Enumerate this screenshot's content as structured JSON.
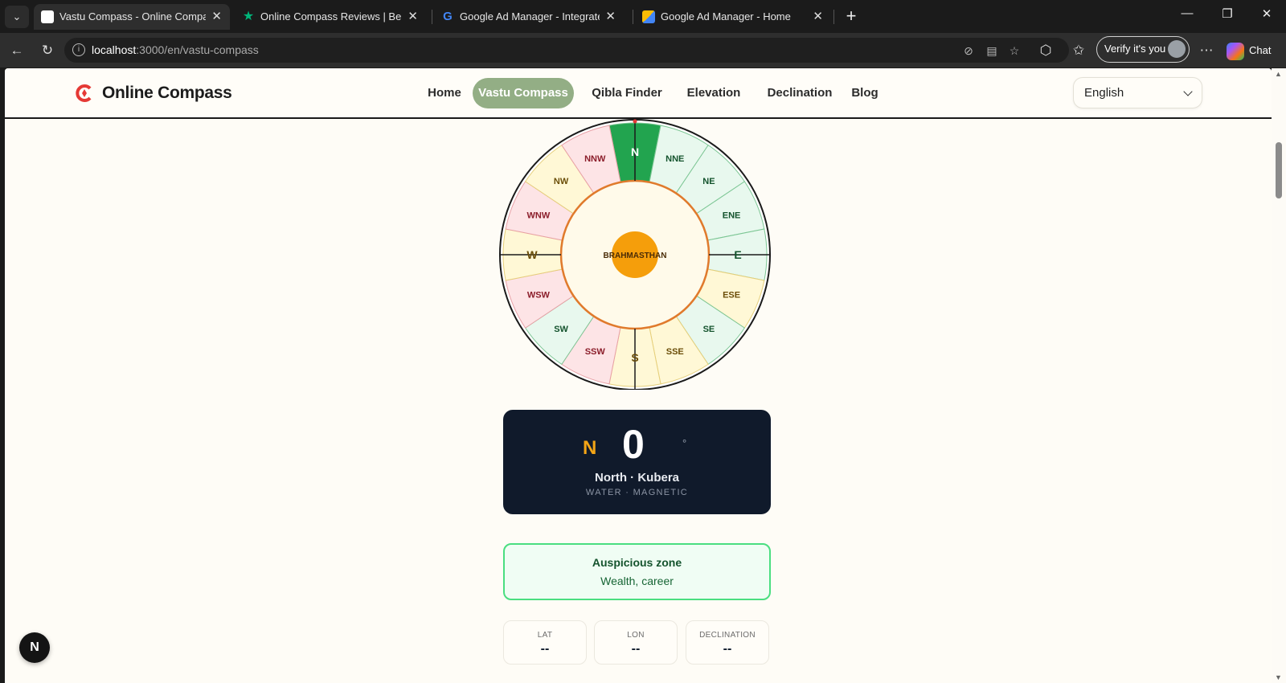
{
  "browser": {
    "tabs": [
      {
        "title": "Vastu Compass - Online Compass",
        "favicon_color": "#e53935",
        "active": true
      },
      {
        "title": "Online Compass Reviews | Be the fi",
        "favicon_color": "#00b67a",
        "active": false
      },
      {
        "title": "Google Ad Manager - Integrated A",
        "favicon_color": "#4285f4",
        "active": false
      },
      {
        "title": "Google Ad Manager - Home",
        "favicon_color": "#fbbc04",
        "active": false
      }
    ],
    "url_host": "localhost",
    "url_rest": ":3000/en/vastu-compass",
    "verify_label": "Verify it's you",
    "chat_label": "Chat"
  },
  "site": {
    "brand": "Online Compass",
    "nav": [
      "Home",
      "Vastu Compass",
      "Qibla Finder",
      "Elevation",
      "Declination",
      "Blog"
    ],
    "active_nav": "Vastu Compass",
    "language": "English"
  },
  "compass": {
    "center_label": "BRAHMASTHAN",
    "zones": [
      {
        "label": "N",
        "color": "green-active"
      },
      {
        "label": "NNE",
        "color": "green"
      },
      {
        "label": "NE",
        "color": "green"
      },
      {
        "label": "ENE",
        "color": "green"
      },
      {
        "label": "E",
        "color": "green"
      },
      {
        "label": "ESE",
        "color": "yellow"
      },
      {
        "label": "SE",
        "color": "green"
      },
      {
        "label": "SSE",
        "color": "yellow"
      },
      {
        "label": "S",
        "color": "yellow"
      },
      {
        "label": "SSW",
        "color": "red"
      },
      {
        "label": "SW",
        "color": "green"
      },
      {
        "label": "WSW",
        "color": "red"
      },
      {
        "label": "W",
        "color": "yellow"
      },
      {
        "label": "WNW",
        "color": "red"
      },
      {
        "label": "NW",
        "color": "yellow"
      },
      {
        "label": "NNW",
        "color": "red"
      }
    ],
    "colors": {
      "green": "#e8f8ee",
      "green_active": "#22a44f",
      "yellow": "#fff8d6",
      "red": "#fde4e6",
      "ring": "#e07a2c",
      "center_dot": "#f59e0b"
    }
  },
  "reading": {
    "direction": "N",
    "degrees": "0",
    "degree_symbol": "°",
    "name": "North · Kubera",
    "sub": "WATER · MAGNETIC"
  },
  "zone_info": {
    "title": "Auspicious zone",
    "text": "Wealth, career"
  },
  "stats": [
    {
      "label": "LAT",
      "value": "--"
    },
    {
      "label": "LON",
      "value": "--"
    },
    {
      "label": "DECLINATION",
      "value": "--"
    }
  ],
  "dev_badge": "N"
}
